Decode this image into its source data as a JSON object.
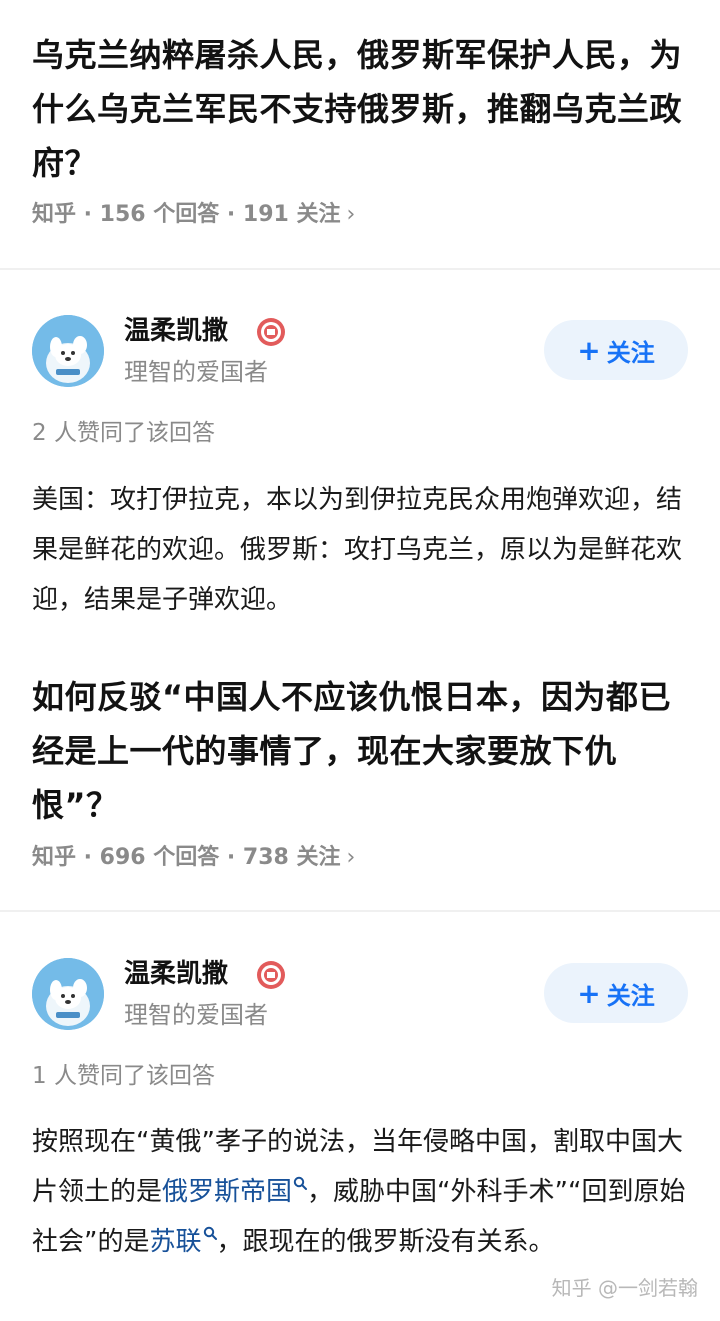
{
  "feed": {
    "items": [
      {
        "question": {
          "title": "乌克兰纳粹屠杀人民，俄罗斯军保护人民，为什么乌克兰军民不支持俄罗斯，推翻乌克兰政府？",
          "meta": "知乎 · 156 个回答 · 191 关注",
          "chevron": "›"
        },
        "author": {
          "name": "温柔凯撒",
          "bio": "理智的爱国者",
          "follow_label": "关注",
          "follow_plus": "+"
        },
        "likes": "2 人赞同了该回答",
        "answer": "美国：攻打伊拉克，本以为到伊拉克民众用炮弹欢迎，结果是鲜花的欢迎。俄罗斯：攻打乌克兰，原以为是鲜花欢迎，结果是子弹欢迎。"
      },
      {
        "question": {
          "title": "如何反驳“中国人不应该仇恨日本，因为都已经是上一代的事情了，现在大家要放下仇恨”？",
          "meta": "知乎 · 696 个回答 · 738 关注",
          "chevron": "›"
        },
        "author": {
          "name": "温柔凯撒",
          "bio": "理智的爱国者",
          "follow_label": "关注",
          "follow_plus": "+"
        },
        "likes": "1 人赞同了该回答",
        "answer_parts": {
          "p1": "按照现在“黄俄”孝子的说法，当年侵略中国，割取中国大片领土的是",
          "link1": "俄罗斯帝国",
          "p2": "，威胁中国“外科手术”“回到原始社会”的是",
          "link2": "苏联",
          "p3": "，跟现在的俄罗斯没有关系。"
        }
      }
    ]
  },
  "watermark": "知乎 @一剑若翰",
  "colors": {
    "link": "#175199",
    "follow_text": "#1772f6",
    "follow_bg": "#ebf3fc",
    "meta": "#8a8a8a"
  },
  "icons": {
    "avatar": "dog-avatar-icon",
    "badge": "patriot-badge-icon",
    "chevron": "chevron-right-icon",
    "search": "search-icon"
  }
}
